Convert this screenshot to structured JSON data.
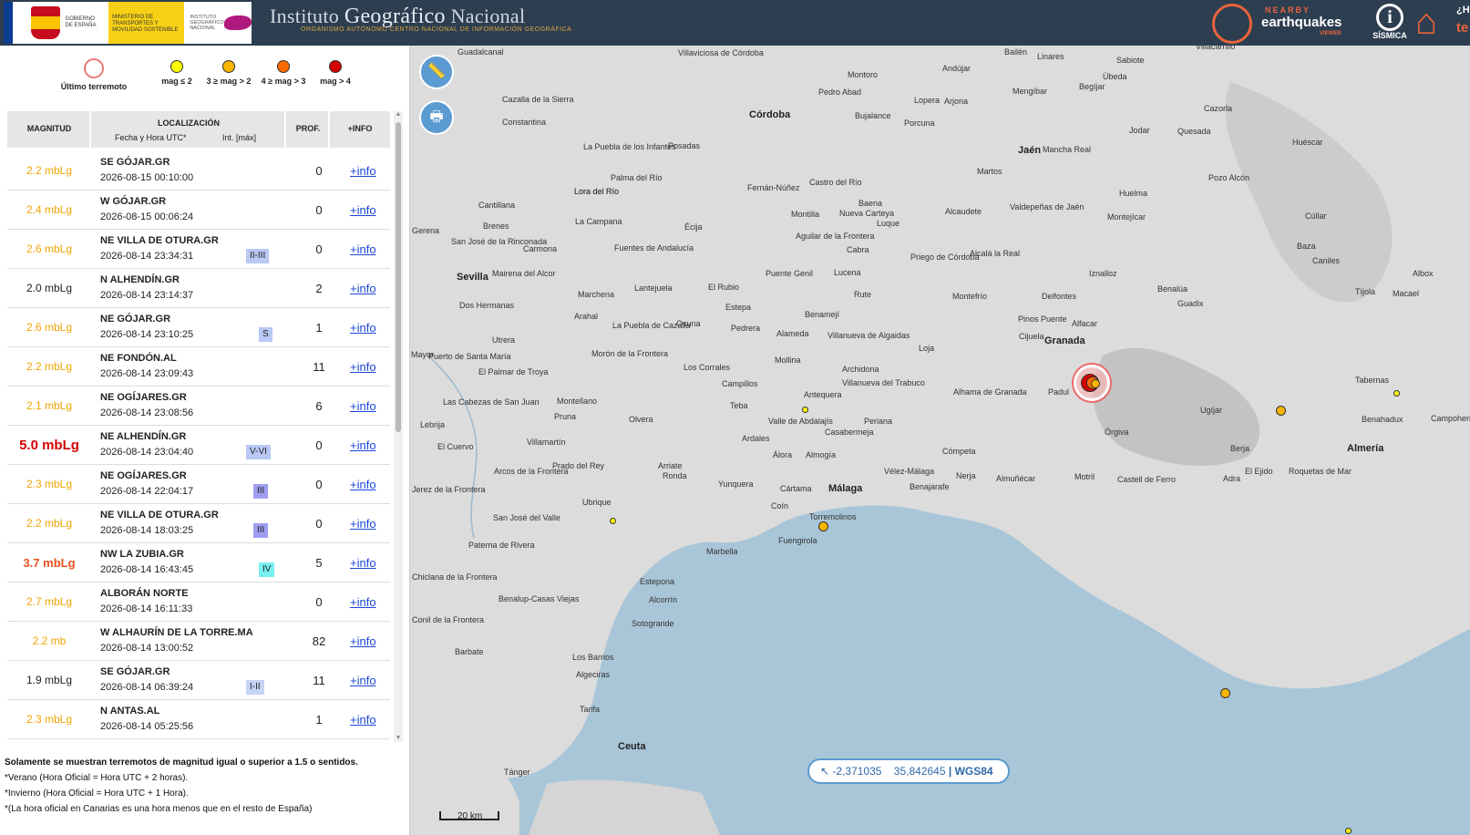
{
  "header": {
    "gov_text": "GOBIERNO DE ESPAÑA",
    "ministry_text": "MINISTERIO DE TRANSPORTES Y MOVILIDAD SOSTENIBLE",
    "ign_small_text": "INSTITUTO GEOGRÁFICO NACIONAL",
    "title_pre": "Instituto ",
    "title_main": "Geográfico",
    "title_post": " Nacional",
    "subtitle": "ORGANISMO AUTÓNOMO CENTRO NACIONAL DE INFORMACIÓN GEOGRÁFICA",
    "nearby_small": "NEARBY",
    "nearby_big": "earthquakes",
    "nearby_viewer": "VIEWER",
    "info_symbol": "i",
    "info_label": "SÍSMICA",
    "house_small": "¿HA",
    "house_big": "te"
  },
  "legend": {
    "last_quake": "Último terremoto",
    "items": [
      {
        "label": "mag ≤ 2",
        "color": "#ffff00"
      },
      {
        "label": "3 ≥ mag > 2",
        "color": "#f7b500"
      },
      {
        "label": "4 ≥ mag > 3",
        "color": "#ff6a00"
      },
      {
        "label": "mag > 4",
        "color": "#d40000"
      }
    ]
  },
  "table": {
    "col_mag": "MAGNITUD",
    "col_loc": "LOCALIZACIÓN",
    "col_date": "Fecha y Hora UTC*",
    "col_int": "Int. [máx]",
    "col_prof": "PROF.",
    "col_info": "+INFO",
    "rows": [
      {
        "mag": "2.2 mbLg",
        "loc": "SE GÓJAR.GR",
        "date": "2026-08-15 00:10:00",
        "int": "",
        "prof": "0",
        "more": "+info"
      },
      {
        "mag": "2.4 mbLg",
        "loc": "W GÓJAR.GR",
        "date": "2026-08-15 00:06:24",
        "int": "",
        "prof": "0",
        "more": "+info"
      },
      {
        "mag": "2.6 mbLg",
        "loc": "NE VILLA DE OTURA.GR",
        "date": "2026-08-14 23:34:31",
        "int": "II-III",
        "prof": "0",
        "more": "+info"
      },
      {
        "mag": "2.0 mbLg",
        "loc": "N ALHENDÍN.GR",
        "date": "2026-08-14 23:14:37",
        "int": "",
        "prof": "2",
        "more": "+info"
      },
      {
        "mag": "2.6 mbLg",
        "loc": "NE GÓJAR.GR",
        "date": "2026-08-14 23:10:25",
        "int": "S",
        "prof": "1",
        "more": "+info"
      },
      {
        "mag": "2.2 mbLg",
        "loc": "NE FONDÓN.AL",
        "date": "2026-08-14 23:09:43",
        "int": "",
        "prof": "11",
        "more": "+info"
      },
      {
        "mag": "2.1 mbLg",
        "loc": "NE OGÍJARES.GR",
        "date": "2026-08-14 23:08:56",
        "int": "",
        "prof": "6",
        "more": "+info"
      },
      {
        "mag": "5.0 mbLg",
        "loc": "NE ALHENDÍN.GR",
        "date": "2026-08-14 23:04:40",
        "int": "V-VI",
        "prof": "0",
        "more": "+info"
      },
      {
        "mag": "2.3 mbLg",
        "loc": "NE OGÍJARES.GR",
        "date": "2026-08-14 22:04:17",
        "int": "III",
        "prof": "0",
        "more": "+info"
      },
      {
        "mag": "2.2 mbLg",
        "loc": "NE VILLA DE OTURA.GR",
        "date": "2026-08-14 18:03:25",
        "int": "III",
        "prof": "0",
        "more": "+info"
      },
      {
        "mag": "3.7 mbLg",
        "loc": "NW LA ZUBIA.GR",
        "date": "2026-08-14 16:43:45",
        "int": "IV",
        "prof": "5",
        "more": "+info"
      },
      {
        "mag": "2.7 mbLg",
        "loc": "ALBORÁN NORTE",
        "date": "2026-08-14 16:11:33",
        "int": "",
        "prof": "0",
        "more": "+info"
      },
      {
        "mag": "2.2 mb",
        "loc": "W ALHAURÍN DE LA TORRE.MA",
        "date": "2026-08-14 13:00:52",
        "int": "",
        "prof": "82",
        "more": "+info"
      },
      {
        "mag": "1.9 mbLg",
        "loc": "SE GÓJAR.GR",
        "date": "2026-08-14 06:39:24",
        "int": "I-II",
        "prof": "11",
        "more": "+info"
      },
      {
        "mag": "2.3 mbLg",
        "loc": "N ANTAS.AL",
        "date": "2026-08-14 05:25:56",
        "int": "",
        "prof": "1",
        "more": "+info"
      }
    ]
  },
  "colors": {
    "mag_low": "#222222",
    "mag_mid": "#f0a500",
    "mag_high": "#e8501c",
    "mag_max": "#d40000",
    "int_II-III": "#b9c8f5",
    "int_S": "#b9c8f5",
    "int_V-VI": "#b9c8f5",
    "int_III": "#9e9ef0",
    "int_IV": "#79f0f0",
    "int_I-II": "#c5d3f5"
  },
  "notes": [
    "Solamente se muestran terremotos de magnitud igual o superior a 1.5 o sentidos.",
    "*Verano (Hora Oficial = Hora UTC + 2 horas).",
    "*Invierno (Hora Oficial = Hora UTC + 1 Hora).",
    "*(La hora oficial en Canarias es una hora menos que en el resto de España)"
  ],
  "map": {
    "coord_lon": "-2,371035",
    "coord_lat": "35,842645",
    "coord_sys": "WGS84",
    "scale": "20 km",
    "ruler_icon": "ruler-icon",
    "print_icon": "printer-icon",
    "labels": [
      {
        "t": "Guadalcanal"
      },
      {
        "t": "Villaviciosa de Córdoba"
      },
      {
        "t": "Montoro"
      },
      {
        "t": "Andújar"
      },
      {
        "t": "Bailén"
      },
      {
        "t": "Linares"
      },
      {
        "t": "Sabiote"
      },
      {
        "t": "Úbeda"
      },
      {
        "t": "Cazalla de la Sierra"
      },
      {
        "t": "Posadas"
      },
      {
        "t": "Córdoba"
      },
      {
        "t": "Pedro Abad"
      },
      {
        "t": "Bujalance"
      },
      {
        "t": "Lopera"
      },
      {
        "t": "Arjona"
      },
      {
        "t": "Mengíbar"
      },
      {
        "t": "Begíjar"
      },
      {
        "t": "Constantina"
      },
      {
        "t": "Porcuna"
      },
      {
        "t": "Jodar"
      },
      {
        "t": "Quesada"
      },
      {
        "t": "Cazorla"
      },
      {
        "t": "La Puebla de los Infantes"
      },
      {
        "t": "Jaén"
      },
      {
        "t": "Mancha Real"
      },
      {
        "t": "Huéscar"
      },
      {
        "t": "Palma del Río"
      },
      {
        "t": "Lora del Río"
      },
      {
        "t": "Martos"
      },
      {
        "t": "Pozo Alcón"
      },
      {
        "t": "Fernán-Núñez"
      },
      {
        "t": "Castro del Río"
      },
      {
        "t": "Huelma"
      },
      {
        "t": "Cantillana"
      },
      {
        "t": "Montilla"
      },
      {
        "t": "Baena"
      },
      {
        "t": "Nueva Carteya"
      },
      {
        "t": "Alcaudete"
      },
      {
        "t": "Valdepeñas de Jaén"
      },
      {
        "t": "Montejícar"
      },
      {
        "t": "Cúllar"
      },
      {
        "t": "Brenes"
      },
      {
        "t": "La Campana"
      },
      {
        "t": "Écija"
      },
      {
        "t": "Aguilar de la Frontera"
      },
      {
        "t": "Luque"
      },
      {
        "t": "Gerena"
      },
      {
        "t": "San José de la Rinconada"
      },
      {
        "t": "Carmona"
      },
      {
        "t": "Fuentes de Andalucía"
      },
      {
        "t": "Cabra"
      },
      {
        "t": "Priego de Córdoba"
      },
      {
        "t": "Alcalá la Real"
      },
      {
        "t": "Baza"
      },
      {
        "t": "Caniles"
      },
      {
        "t": "Sevilla"
      },
      {
        "t": "Mairena del Alcor"
      },
      {
        "t": "Puente Genil"
      },
      {
        "t": "Lucena"
      },
      {
        "t": "Iznalloz"
      },
      {
        "t": "Lantejuela"
      },
      {
        "t": "El Rubio"
      },
      {
        "t": "Marchena"
      },
      {
        "t": "Rute"
      },
      {
        "t": "Montefrío"
      },
      {
        "t": "Deifontes"
      },
      {
        "t": "Benalúa"
      },
      {
        "t": "Tíjola"
      },
      {
        "t": "Macael"
      },
      {
        "t": "Dos Hermanas"
      },
      {
        "t": "Arahal"
      },
      {
        "t": "Estepa"
      },
      {
        "t": "Benamejí"
      },
      {
        "t": "Guadix"
      },
      {
        "t": "Pinos Puente"
      },
      {
        "t": "Alfacar"
      },
      {
        "t": "La Puebla de Cazalla"
      },
      {
        "t": "Osuna"
      },
      {
        "t": "Pedrera"
      },
      {
        "t": "Utrera"
      },
      {
        "t": "Alameda"
      },
      {
        "t": "Villanueva de Algaidas"
      },
      {
        "t": "Loja"
      },
      {
        "t": "Cijuela"
      },
      {
        "t": "Granada"
      },
      {
        "t": "Morón de la Frontera"
      },
      {
        "t": "Los Corrales"
      },
      {
        "t": "Mollina"
      },
      {
        "t": "Archidona"
      },
      {
        "t": "Padul"
      },
      {
        "t": "El Palmar de Troya"
      },
      {
        "t": "Campillos"
      },
      {
        "t": "Antequera"
      },
      {
        "t": "Villanueva del Trabuco"
      },
      {
        "t": "Alhama de Granada"
      },
      {
        "t": "Tabernas"
      },
      {
        "t": "Las Cabezas de San Juan"
      },
      {
        "t": "Montellano"
      },
      {
        "t": "Teba"
      },
      {
        "t": "Ugíjar"
      },
      {
        "t": "Lebrija"
      },
      {
        "t": "Pruna"
      },
      {
        "t": "Olvera"
      },
      {
        "t": "Valle de Abdalajís"
      },
      {
        "t": "Periana"
      },
      {
        "t": "Órgiva"
      },
      {
        "t": "Benahadux"
      },
      {
        "t": "Campohermoso"
      },
      {
        "t": "El Cuervo"
      },
      {
        "t": "Villamartín"
      },
      {
        "t": "Ardales"
      },
      {
        "t": "Casabermeja"
      },
      {
        "t": "Berja"
      },
      {
        "t": "Almería"
      },
      {
        "t": "Álora"
      },
      {
        "t": "Almogía"
      },
      {
        "t": "Cómpeta"
      },
      {
        "t": "Prado del Rey"
      },
      {
        "t": "Arriate"
      },
      {
        "t": "Vélez-Málaga"
      },
      {
        "t": "Nerja"
      },
      {
        "t": "Almuñécar"
      },
      {
        "t": "Motril"
      },
      {
        "t": "Castell de Ferro"
      },
      {
        "t": "Adra"
      },
      {
        "t": "El Ejido"
      },
      {
        "t": "Roquetas de Mar"
      },
      {
        "t": "Arcos de la Frontera"
      },
      {
        "t": "Ronda"
      },
      {
        "t": "Yunquera"
      },
      {
        "t": "Cártama"
      },
      {
        "t": "Málaga"
      },
      {
        "t": "Benajarafe"
      },
      {
        "t": "Jerez de la Frontera"
      },
      {
        "t": "Ubrique"
      },
      {
        "t": "Coín"
      },
      {
        "t": "Torremolinos"
      },
      {
        "t": "San José del Valle"
      },
      {
        "t": "Fuengirola"
      },
      {
        "t": "Paterna de Rivera"
      },
      {
        "t": "Marbella"
      },
      {
        "t": "Estepona"
      },
      {
        "t": "Chiclana de la Frontera"
      },
      {
        "t": "Benalup-Casas Viejas"
      },
      {
        "t": "Alcorrín"
      },
      {
        "t": "Conil de la Frontera"
      },
      {
        "t": "Sotogrande"
      },
      {
        "t": "Barbate"
      },
      {
        "t": "Los Barrios"
      },
      {
        "t": "Algeciras"
      },
      {
        "t": "Tarifa"
      },
      {
        "t": "Ceuta"
      },
      {
        "t": "Tánger"
      },
      {
        "t": "Puerto de Santa María"
      },
      {
        "t": "Mayor"
      },
      {
        "t": "Villacarrillo"
      },
      {
        "t": "Albox"
      },
      {
        "t": "Lora del Río"
      }
    ]
  }
}
